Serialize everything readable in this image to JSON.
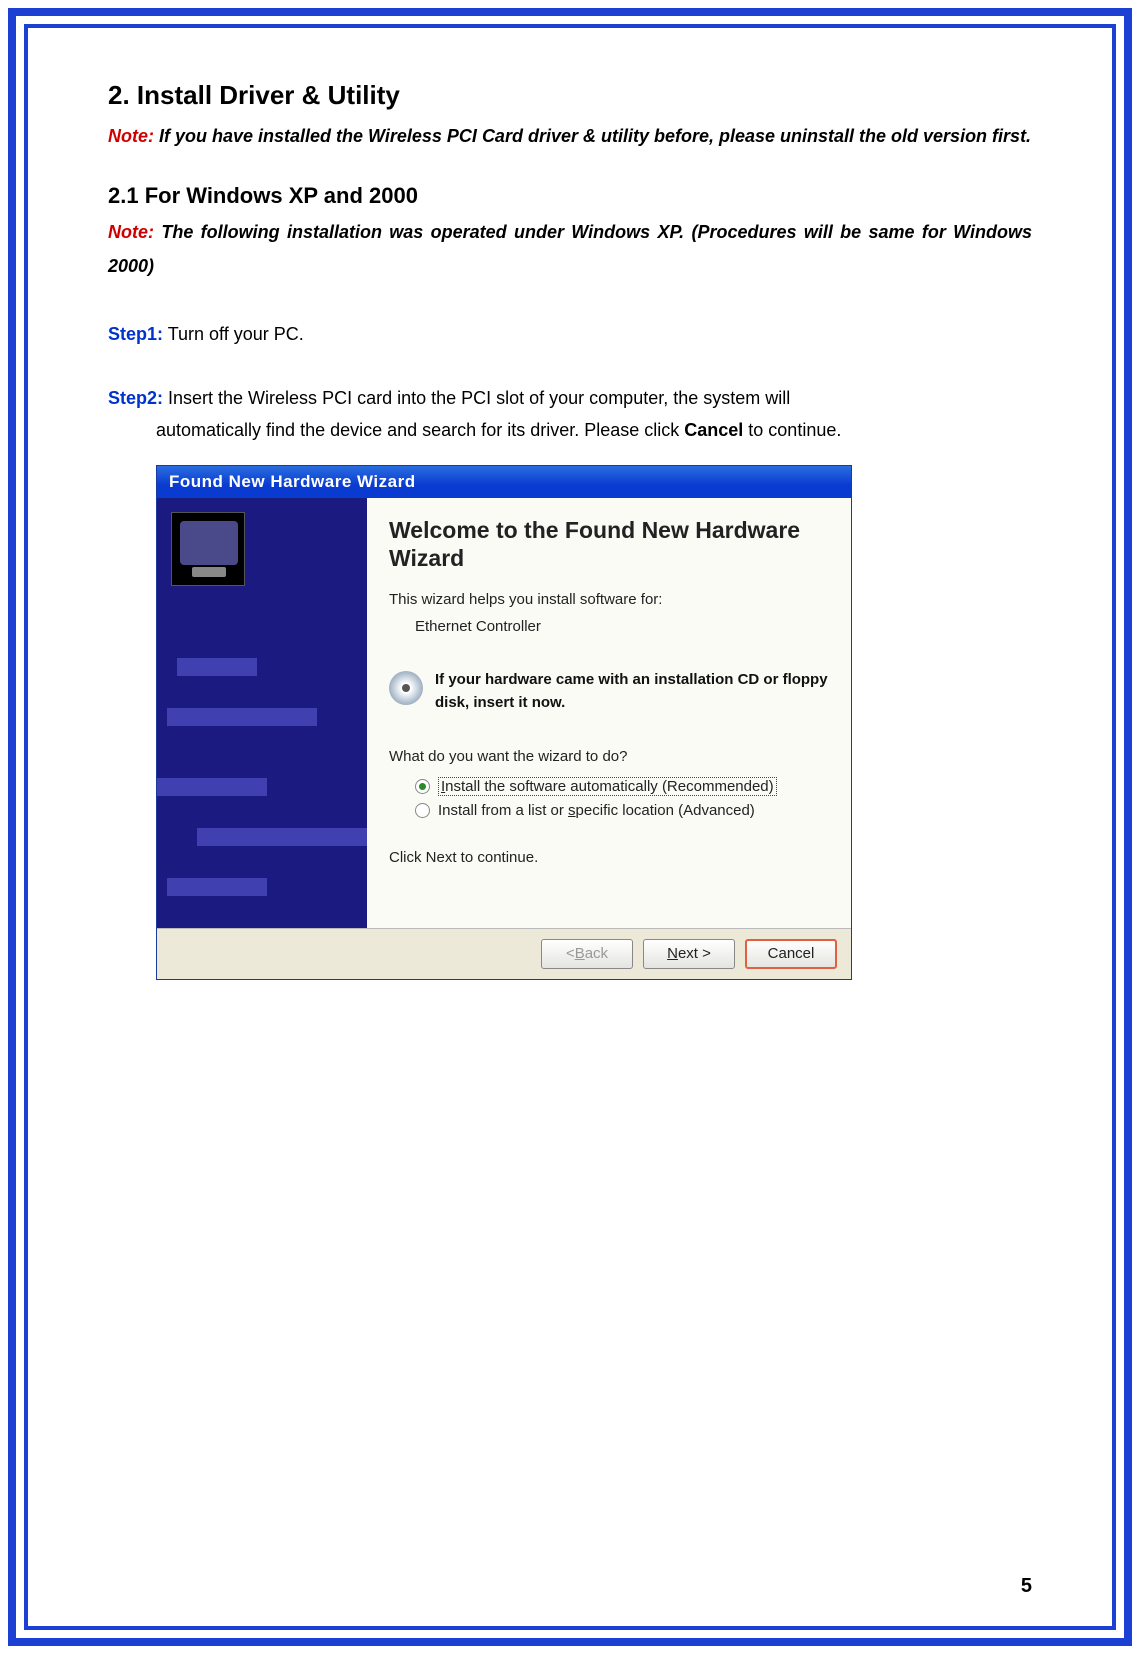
{
  "heading": "2.  Install Driver & Utility",
  "note1_label": "Note:",
  "note1_text": " If you have installed the Wireless PCI Card driver & utility before, please uninstall the old version first.",
  "subheading": "2.1  For Windows XP and 2000",
  "note2_label": "Note:",
  "note2_text": " The following installation was operated under Windows XP. (Procedures will be same for Windows 2000)",
  "step1_label": "Step1:",
  "step1_text": " Turn off your PC.",
  "step2_label": "Step2:",
  "step2_text_a": " Insert the Wireless PCI card into the PCI slot of your computer, the system will",
  "step2_text_b": "automatically find the device and search for its driver. Please click ",
  "step2_bold": "Cancel",
  "step2_text_c": " to continue.",
  "wizard": {
    "titlebar": "Found New Hardware Wizard",
    "welcome": "Welcome to the Found New Hardware Wizard",
    "helps": "This wizard helps you install software for:",
    "device": "Ethernet Controller",
    "cd_text": "If your hardware came with an installation CD or floppy disk, insert it now.",
    "ask": "What do you want the wizard to do?",
    "opt1_pre": "I",
    "opt1_rest": "nstall the software automatically (Recommended)",
    "opt2_pre": "Install from a list or ",
    "opt2_u": "s",
    "opt2_rest": "pecific location (Advanced)",
    "continue": "Click Next to continue.",
    "back_pre": "< ",
    "back_u": "B",
    "back_rest": "ack",
    "next_u": "N",
    "next_rest": "ext >",
    "cancel": "Cancel"
  },
  "page_number": "5"
}
